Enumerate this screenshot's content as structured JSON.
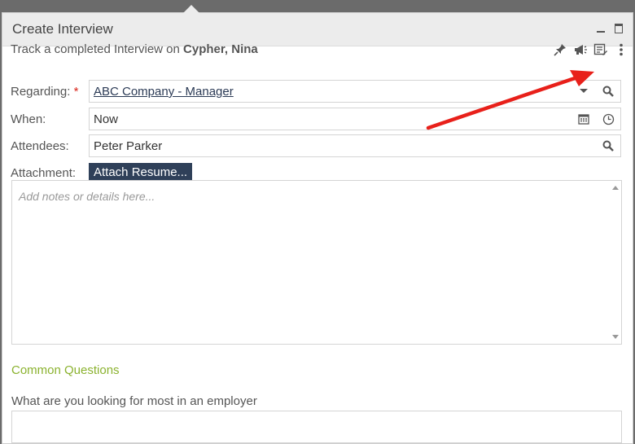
{
  "dialog": {
    "title": "Create Interview",
    "subtitle_prefix": "Track a completed Interview on ",
    "subtitle_name": "Cypher, Nina"
  },
  "toolbar": {
    "icons": [
      "pin-icon",
      "megaphone-icon",
      "notes-icon",
      "more-vertical-icon"
    ]
  },
  "form": {
    "regarding": {
      "label": "Regarding:",
      "required_mark": "*",
      "value": "ABC Company - Manager"
    },
    "when": {
      "label": "When:",
      "value": "Now"
    },
    "attendees": {
      "label": "Attendees:",
      "value": "Peter Parker"
    },
    "attachment": {
      "label": "Attachment:",
      "button_label": "Attach Resume..."
    }
  },
  "notes": {
    "placeholder": "Add notes or details here..."
  },
  "common_questions": {
    "title": "Common Questions",
    "questions": [
      "What are you looking for most in an employer"
    ]
  },
  "colors": {
    "accent_green": "#8bb22f",
    "button_navy": "#2f4059",
    "annotation_arrow": "#e8201a"
  }
}
